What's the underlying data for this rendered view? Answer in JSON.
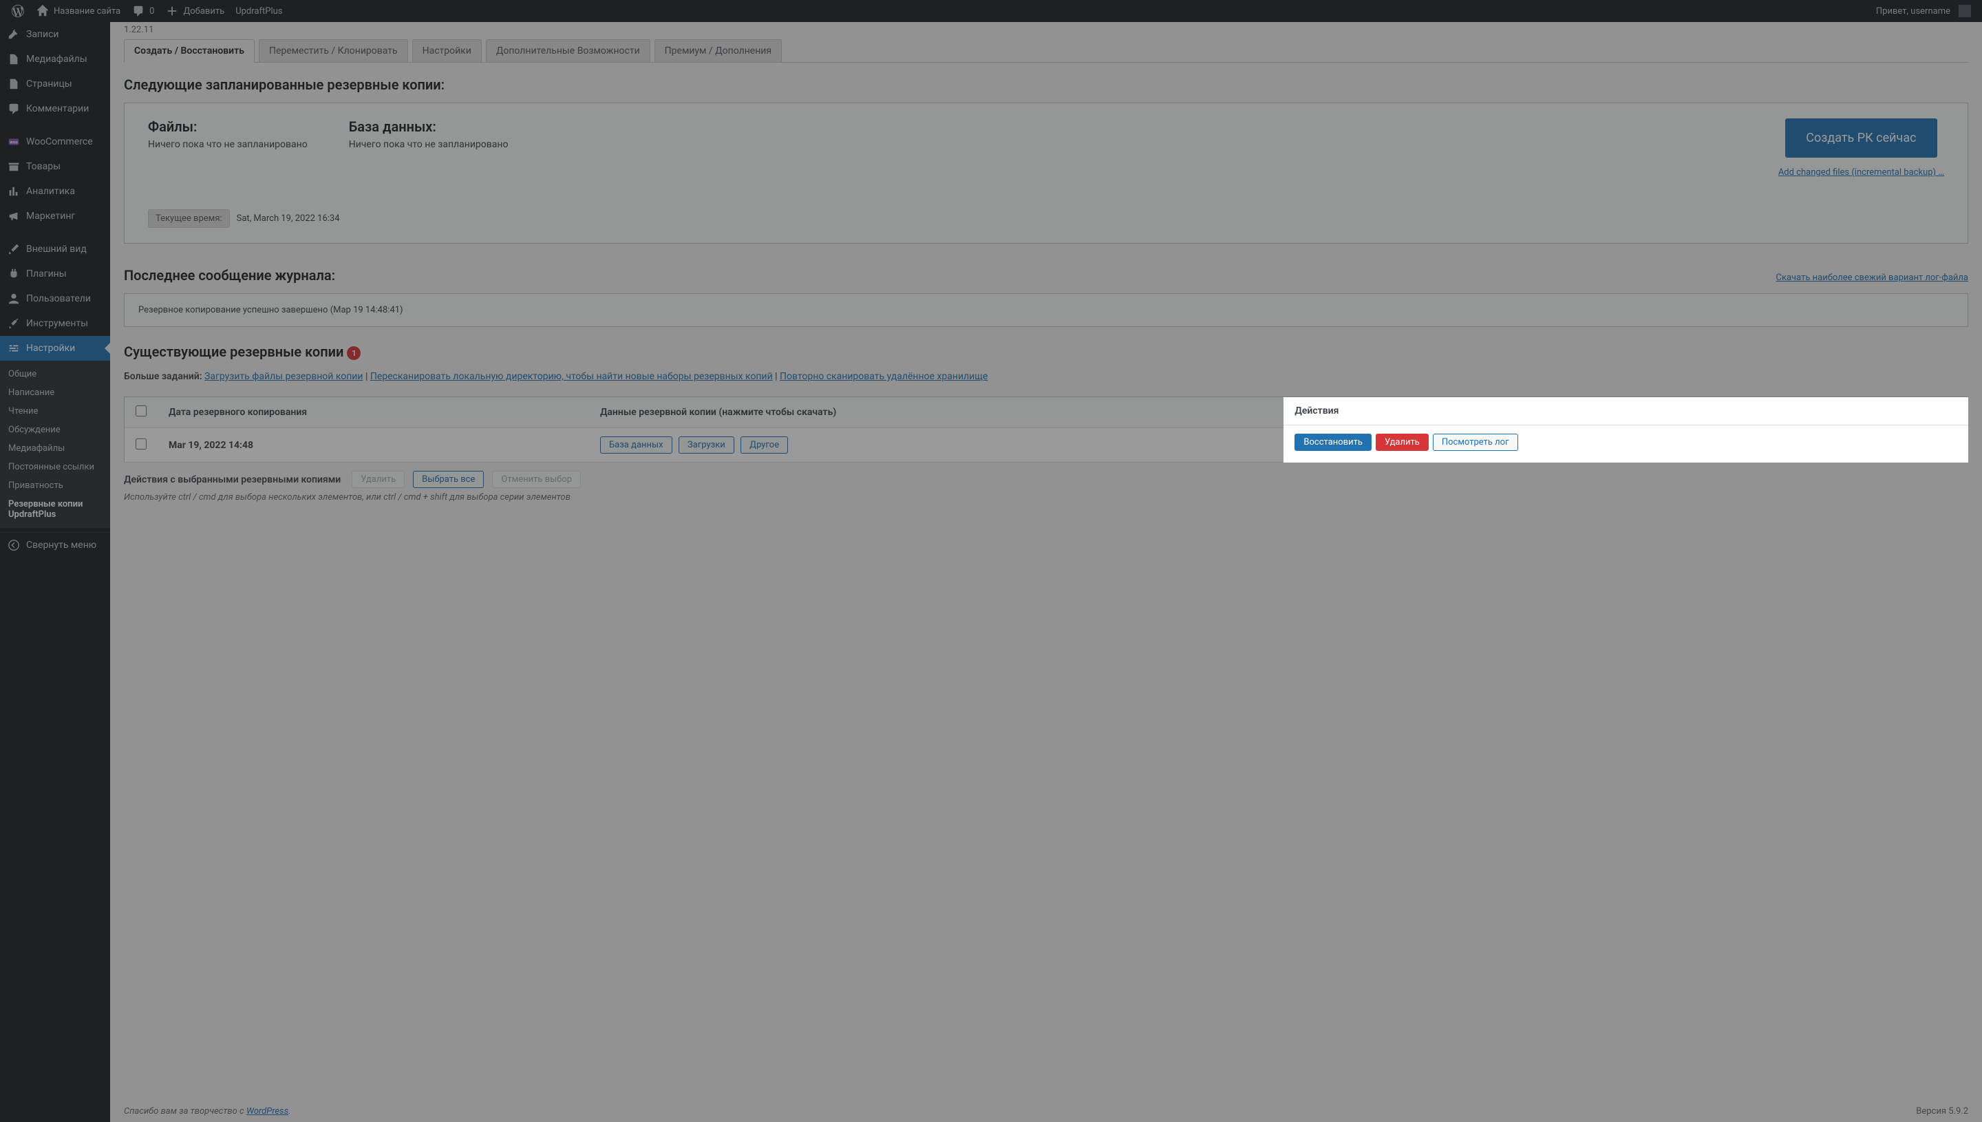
{
  "adminbar": {
    "site_name": "Название сайта",
    "comments_count": "0",
    "add_new": "Добавить",
    "plugin": "UpdraftPlus",
    "greeting": "Привет, username"
  },
  "sidebar": {
    "items": [
      {
        "label": "Записи"
      },
      {
        "label": "Медиафайлы"
      },
      {
        "label": "Страницы"
      },
      {
        "label": "Комментарии"
      },
      {
        "label": "WooCommerce"
      },
      {
        "label": "Товары"
      },
      {
        "label": "Аналитика"
      },
      {
        "label": "Маркетинг"
      },
      {
        "label": "Внешний вид"
      },
      {
        "label": "Плагины"
      },
      {
        "label": "Пользователи"
      },
      {
        "label": "Инструменты"
      },
      {
        "label": "Настройки"
      }
    ],
    "submenu": [
      "Общие",
      "Написание",
      "Чтение",
      "Обсуждение",
      "Медиафайлы",
      "Постоянные ссылки",
      "Приватность",
      "Резервные копии UpdraftPlus"
    ],
    "collapse": "Свернуть меню"
  },
  "version_top": "1.22.11",
  "tabs": [
    "Создать / Восстановить",
    "Переместить / Клонировать",
    "Настройки",
    "Дополнительные Возможности",
    "Премиум / Дополнения"
  ],
  "section_next_scheduled": "Следующие запланированные резервные копии:",
  "sched": {
    "files_label": "Файлы:",
    "files_value": "Ничего пока что не запланировано",
    "db_label": "База данных:",
    "db_value": "Ничего пока что не запланировано",
    "time_label": "Текущее время:",
    "time_value": "Sat, March 19, 2022 16:34",
    "backup_now_btn": "Создать РК сейчас",
    "incremental_link": "Add changed files (incremental backup) …"
  },
  "section_log": "Последнее сообщение журнала:",
  "download_log_link": "Скачать наиболее свежий вариант лог-файла",
  "log_message": "Резервное копирование успешно завершено (Мар 19 14:48:41)",
  "section_existing": "Существующие резервные копии",
  "existing_count": "1",
  "tasks": {
    "label": "Больше заданий:",
    "upload": "Загрузить файлы резервной копии",
    "rescan_local": "Пересканировать локальную директорию, чтобы найти новые наборы резервных копий",
    "rescan_remote": "Повторно сканировать удалённое хранилище"
  },
  "table": {
    "th_date": "Дата резервного копирования",
    "th_data": "Данные резервной копии (нажмите чтобы скачать)",
    "th_actions": "Действия",
    "row": {
      "date": "Mar 19, 2022 14:48",
      "btn_database": "База данных",
      "btn_uploads": "Загрузки",
      "btn_other": "Другое",
      "btn_restore": "Восстановить",
      "btn_delete": "Удалить",
      "btn_viewlog": "Посмотреть лог"
    }
  },
  "bulk": {
    "label": "Действия с выбранными резервными копиями",
    "delete": "Удалить",
    "select_all": "Выбрать все",
    "deselect": "Отменить выбор",
    "hint": "Используйте ctrl / cmd для выбора нескольких элементов, или ctrl / cmd + shift для выбора серии элементов"
  },
  "footer": {
    "thanks_prefix": "Спасибо вам за творчество с ",
    "wordpress": "WordPress",
    "version": "Версия 5.9.2"
  }
}
